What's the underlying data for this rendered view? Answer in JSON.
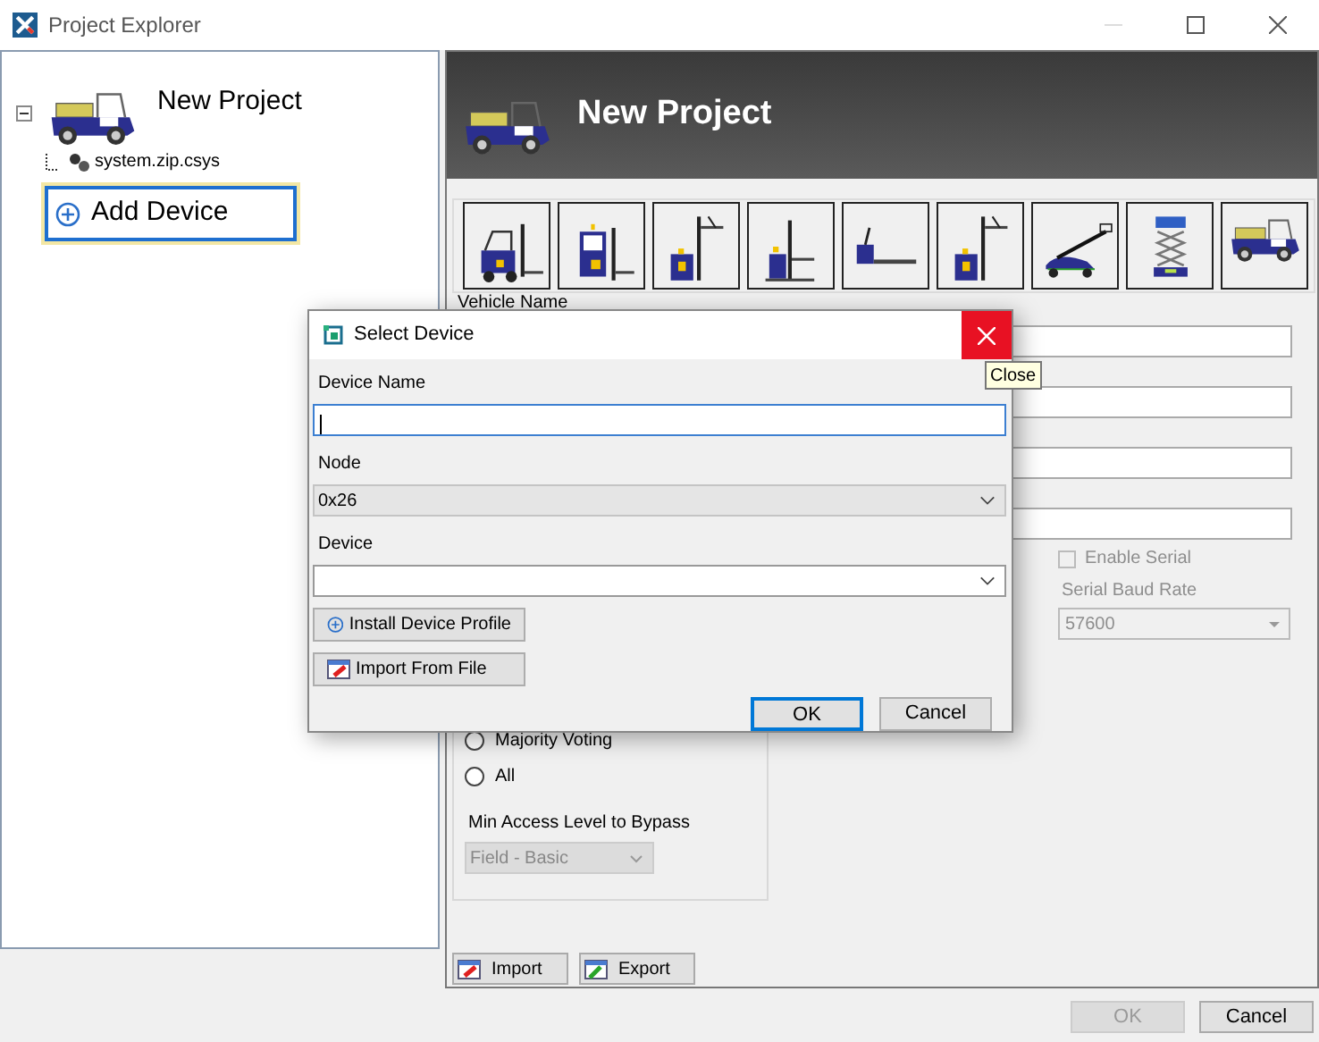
{
  "window": {
    "title": "Project Explorer"
  },
  "tree": [
    {
      "label": "New Project",
      "expanded": true,
      "selected": false,
      "children": [
        {
          "kind": "file",
          "label": "system.zip.csys",
          "selected": false
        },
        {
          "kind": "action",
          "label": "Add Device",
          "selected": true
        }
      ]
    }
  ],
  "header": {
    "title": "New Project"
  },
  "vehicle_types": [
    {
      "kind": "forklift"
    },
    {
      "kind": "stand_forklift"
    },
    {
      "kind": "reach_truck"
    },
    {
      "kind": "stacker"
    },
    {
      "kind": "pallet_truck"
    },
    {
      "kind": "reach_truck"
    },
    {
      "kind": "boom_lift"
    },
    {
      "kind": "scissor_lift"
    },
    {
      "kind": "utility_vehicle"
    }
  ],
  "vehicle_name_label": "Vehicle Name",
  "serial": {
    "enable_label": "Enable Serial",
    "checked": false,
    "disabled": true,
    "baud_label": "Serial Baud Rate",
    "baud_value": "57600"
  },
  "bypass": {
    "options": [
      {
        "label": "Majority Voting",
        "selected": false
      },
      {
        "label": "All",
        "selected": false
      }
    ],
    "min_access_label": "Min Access Level to Bypass",
    "min_access_value": "Field - Basic",
    "disabled": true
  },
  "panel_buttons": [
    {
      "kind": "import",
      "label": "Import"
    },
    {
      "kind": "export",
      "label": "Export"
    }
  ],
  "footer_buttons": [
    {
      "label": "OK",
      "disabled": true
    },
    {
      "label": "Cancel",
      "disabled": false
    }
  ],
  "dialog": {
    "title": "Select Device",
    "close_hovered": true,
    "close_tooltip": "Close",
    "fields": [
      {
        "kind": "text",
        "label": "Device Name",
        "focused": true
      },
      {
        "kind": "dropdown_list",
        "label": "Node",
        "value": "0x26"
      },
      {
        "kind": "combo",
        "label": "Device"
      }
    ],
    "actions": [
      {
        "kind": "install",
        "label": "Install Device Profile"
      },
      {
        "kind": "import",
        "label": "Import From File"
      }
    ],
    "buttons": [
      {
        "label": "OK",
        "default": true
      },
      {
        "label": "Cancel",
        "default": false
      }
    ]
  }
}
